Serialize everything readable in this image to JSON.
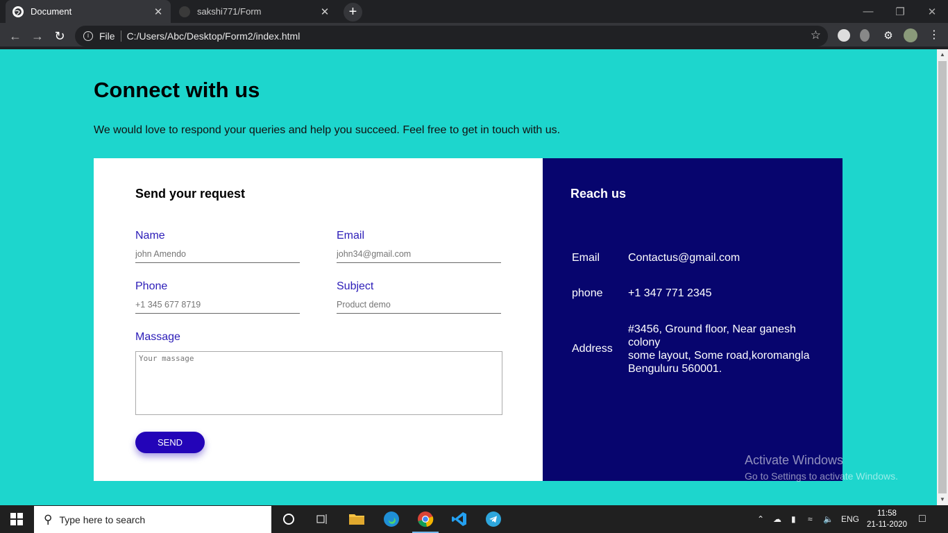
{
  "browser": {
    "tabs": [
      {
        "title": "Document",
        "close": "✕"
      },
      {
        "title": "sakshi771/Form",
        "close": "✕"
      }
    ],
    "new_tab": "+",
    "url_label": "File",
    "url": "C:/Users/Abc/Desktop/Form2/index.html"
  },
  "page": {
    "heading": "Connect with us",
    "lead": "We would love to respond your queries and help you succeed. Feel free to get in touch with us.",
    "form": {
      "title": "Send your request",
      "name_label": "Name",
      "name_placeholder": "john Amendo",
      "email_label": "Email",
      "email_placeholder": "john34@gmail.com",
      "phone_label": "Phone",
      "phone_placeholder": "+1 345 677 8719",
      "subject_label": "Subject",
      "subject_placeholder": "Product demo",
      "message_label": "Massage",
      "message_placeholder": "Your massage",
      "send_label": "SEND"
    },
    "reach": {
      "title": "Reach us",
      "email_key": "Email",
      "email_value": "Contactus@gmail.com",
      "phone_key": "phone",
      "phone_value": "+1 347 771 2345",
      "address_key": "Address",
      "address_line1": "#3456, Ground floor, Near ganesh colony",
      "address_line2": "some layout, Some road,koromangla Benguluru 560001."
    },
    "watermark": {
      "line1": "Activate Windows",
      "line2": "Go to Settings to activate Windows."
    }
  },
  "taskbar": {
    "search_placeholder": "Type here to search",
    "language": "ENG",
    "time": "11:58",
    "date": "21-11-2020"
  },
  "colors": {
    "page_bg": "#1dd6cd",
    "panel_dark": "#07056e",
    "accent": "#2304b8"
  }
}
